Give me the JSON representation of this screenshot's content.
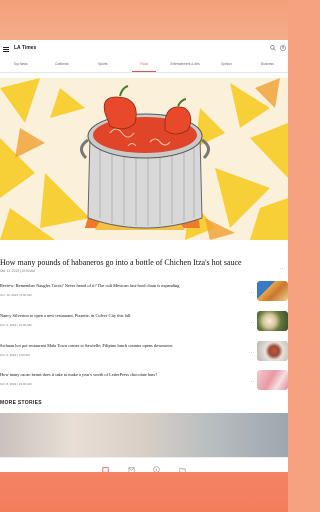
{
  "app": {
    "title": "LA Times"
  },
  "tabs": [
    "Top News",
    "California",
    "Sports",
    "Food",
    "Entertainment & Arts",
    "Opinion",
    "Business"
  ],
  "active_tab": 3,
  "lead": {
    "headline": "How many pounds of habaneros go into a bottle of Chichen Itza's hot sauce",
    "date": "Oct. 11, 2019 | 10:00 AM"
  },
  "stories": [
    {
      "title": "Review: Remember Naugles Tacos? Never heard of it? The cult Mexican fast-food chain is expanding",
      "date": "Oct. 10, 2019 | 8:00 AM"
    },
    {
      "title": "Nancy Silverton to open a new restaurant, Pizzette, in Culver City this fall",
      "date": "Oct. 9, 2019 | 10:00 AM"
    },
    {
      "title": "Sichuan hot pot restaurant Mala Town comes to Sawtelle; Filipino lunch counter opens downtown",
      "date": "Oct. 9, 2019 | 3:00 AM"
    },
    {
      "title": "How many cacao beans does it take to make a year's worth of LetterPress chocolate bars?",
      "date": "Oct. 8, 2019 | 10:00 AM"
    }
  ],
  "more_stories_label": "MORE STORIES",
  "icons": {
    "menu": "menu-icon",
    "search": "search-icon",
    "account": "account-icon",
    "nav": [
      "home-icon",
      "mail-icon",
      "info-icon",
      "folder-icon"
    ]
  },
  "colors": {
    "accent": "#d9534f"
  }
}
